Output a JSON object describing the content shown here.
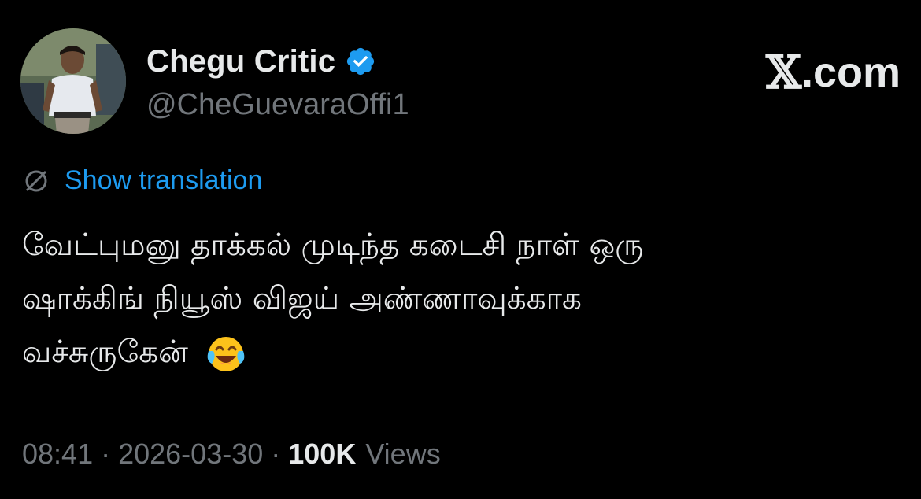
{
  "author": {
    "display_name": "Chegu Critic",
    "handle": "@CheGuevaraOffi1",
    "verified": true,
    "verified_color": "#1d9bf0"
  },
  "brand": {
    "label": ".com",
    "logo": "x-logo-icon"
  },
  "translation": {
    "icon": "globe-icon",
    "label": "Show translation",
    "color": "#1d9bf0"
  },
  "tweet": {
    "lines": [
      "வேட்புமனு தாக்கல் முடிந்த கடைசி நாள் ஒரு",
      "ஷாக்கிங் நியூஸ் விஜய் அண்ணாவுக்காக",
      "வச்சுருகேன்"
    ],
    "emoji": "face-with-tears-of-joy-icon"
  },
  "meta": {
    "time": "08:41",
    "separator": "·",
    "date": "2026-03-30",
    "views_count": "100K",
    "views_label": "Views"
  },
  "colors": {
    "background": "#000000",
    "primary_text": "#e7e9ea",
    "secondary_text": "#71767b",
    "accent": "#1d9bf0"
  }
}
